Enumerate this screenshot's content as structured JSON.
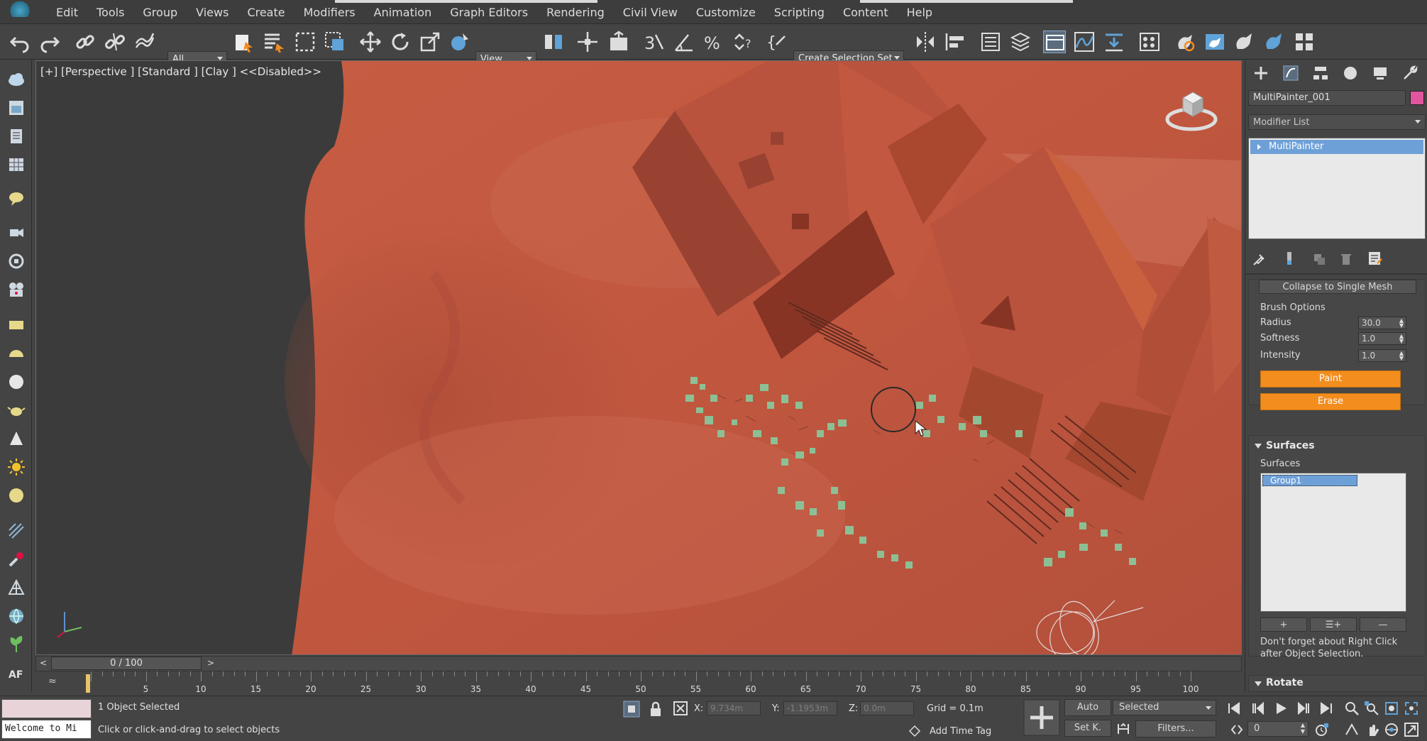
{
  "menu": {
    "items": [
      "Edit",
      "Tools",
      "Group",
      "Views",
      "Create",
      "Modifiers",
      "Animation",
      "Graph Editors",
      "Rendering",
      "Civil View",
      "Customize",
      "Scripting",
      "Content",
      "Help"
    ]
  },
  "toolbar": {
    "selection_filter": "All",
    "reference_coord": "View",
    "selection_set": "Create Selection Set"
  },
  "viewport": {
    "label": "[+] [Perspective ] [Standard ] [Clay ]  <<Disabled>>"
  },
  "command_panel": {
    "object_name": "MultiPainter_001",
    "object_color": "#e0559e",
    "modifier_list_label": "Modifier List",
    "stack_item": "MultiPainter",
    "collapse_button": "Collapse to Single Mesh",
    "brush_options": {
      "title": "Brush Options",
      "radius_label": "Radius",
      "radius_value": "30.0",
      "softness_label": "Softness",
      "softness_value": "1.0",
      "intensity_label": "Intensity",
      "intensity_value": "1.0",
      "paint_label": "Paint",
      "erase_label": "Erase"
    },
    "surfaces": {
      "rollout_title": "Surfaces",
      "group_label": "Surfaces",
      "selected_item": "Group1",
      "add_label": "+",
      "add_list_label": "☰+",
      "remove_label": "—",
      "hint": "Don't forget about Right Click after Object Selection."
    },
    "rotate_rollout_title": "Rotate"
  },
  "timeline": {
    "slider_label": "0 / 100",
    "prev_label": "<",
    "next_label": ">",
    "ticks": [
      "5",
      "10",
      "15",
      "20",
      "25",
      "30",
      "35",
      "40",
      "45",
      "50",
      "55",
      "60",
      "65",
      "70",
      "75",
      "80",
      "85",
      "90",
      "95",
      "100"
    ]
  },
  "status": {
    "listener_text": "Welcome to Mi",
    "selection_count": "1 Object Selected",
    "prompt": "Click or click-and-drag to select objects",
    "x_label": "X:",
    "x_value": "9.734m",
    "y_label": "Y:",
    "y_value": "-1.1953m",
    "z_label": "Z:",
    "z_value": "0.0m",
    "grid": "Grid = 0.1m",
    "add_time_tag": "Add Time Tag",
    "auto_label": "Auto",
    "setkey_label": "Set K.",
    "key_filter": "Selected",
    "filters_label": "Filters...",
    "frame_value": "0"
  },
  "colors": {
    "terrain": "#c45c44",
    "foliage": "#7fb58a",
    "accent_orange": "#f28d1e",
    "selection_blue": "#6ea0d8"
  }
}
